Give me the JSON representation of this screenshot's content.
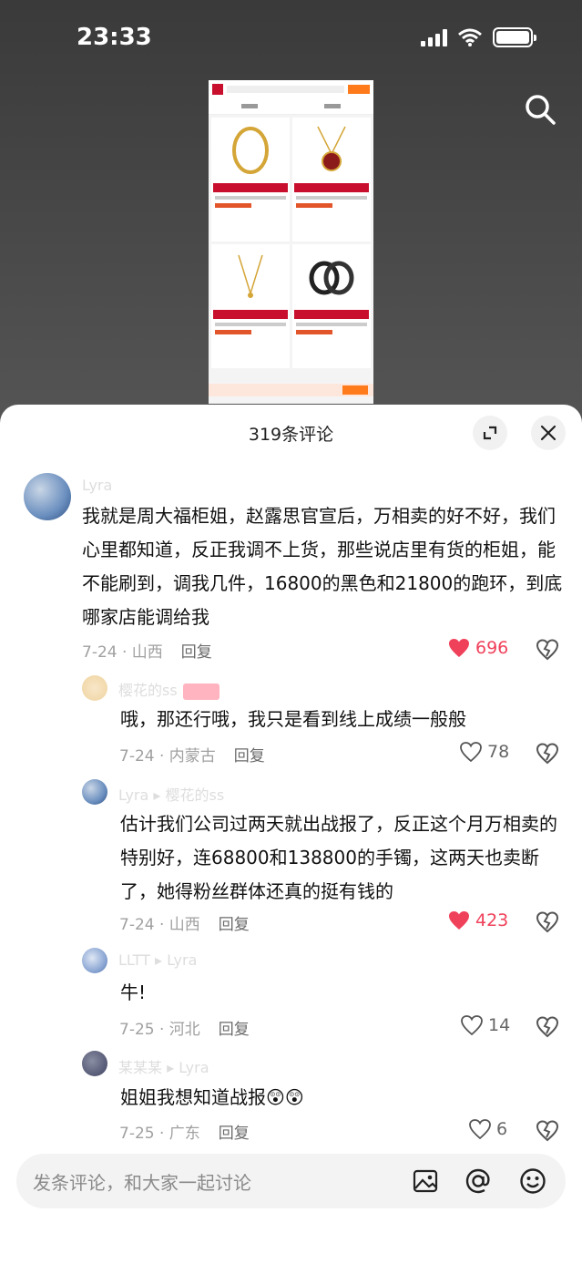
{
  "status_bar": {
    "time": "23:33"
  },
  "sheet": {
    "title": "319条评论"
  },
  "comments": [
    {
      "user": "Lyra",
      "text": "我就是周大福柜姐，赵露思官宣后，万相卖的好不好，我们心里都知道，反正我调不上货，那些说店里有货的柜姐，能不能刷到，调我几件，16800的黑色和21800的跑环，到底哪家店能调给我",
      "date_loc": "7-24 · 山西",
      "reply_label": "回复",
      "likes": "696"
    },
    {
      "user": "樱花的ss",
      "text": "哦，那还行哦，我只是看到线上成绩一般般",
      "date_loc": "7-24 · 内蒙古",
      "reply_label": "回复",
      "likes": "78"
    },
    {
      "user": "Lyra ▸ 樱花的ss",
      "text": "估计我们公司过两天就出战报了，反正这个月万相卖的特别好，连68800和138800的手镯，这两天也卖断了，她得粉丝群体还真的挺有钱的",
      "date_loc": "7-24 · 山西",
      "reply_label": "回复",
      "likes": "423"
    },
    {
      "user": "LLTT ▸ Lyra",
      "text": "牛!",
      "date_loc": "7-25 · 河北",
      "reply_label": "回复",
      "likes": "14"
    },
    {
      "user": "某某某 ▸ Lyra",
      "text": "姐姐我想知道战报😲😲",
      "date_loc": "7-25 · 广东",
      "reply_label": "回复",
      "likes": "6"
    }
  ],
  "input": {
    "placeholder": "发条评论，和大家一起讨论"
  },
  "colors": {
    "like_red": "#f0415b",
    "brand_red": "#c8102e",
    "accent_orange": "#ff7a1a"
  }
}
